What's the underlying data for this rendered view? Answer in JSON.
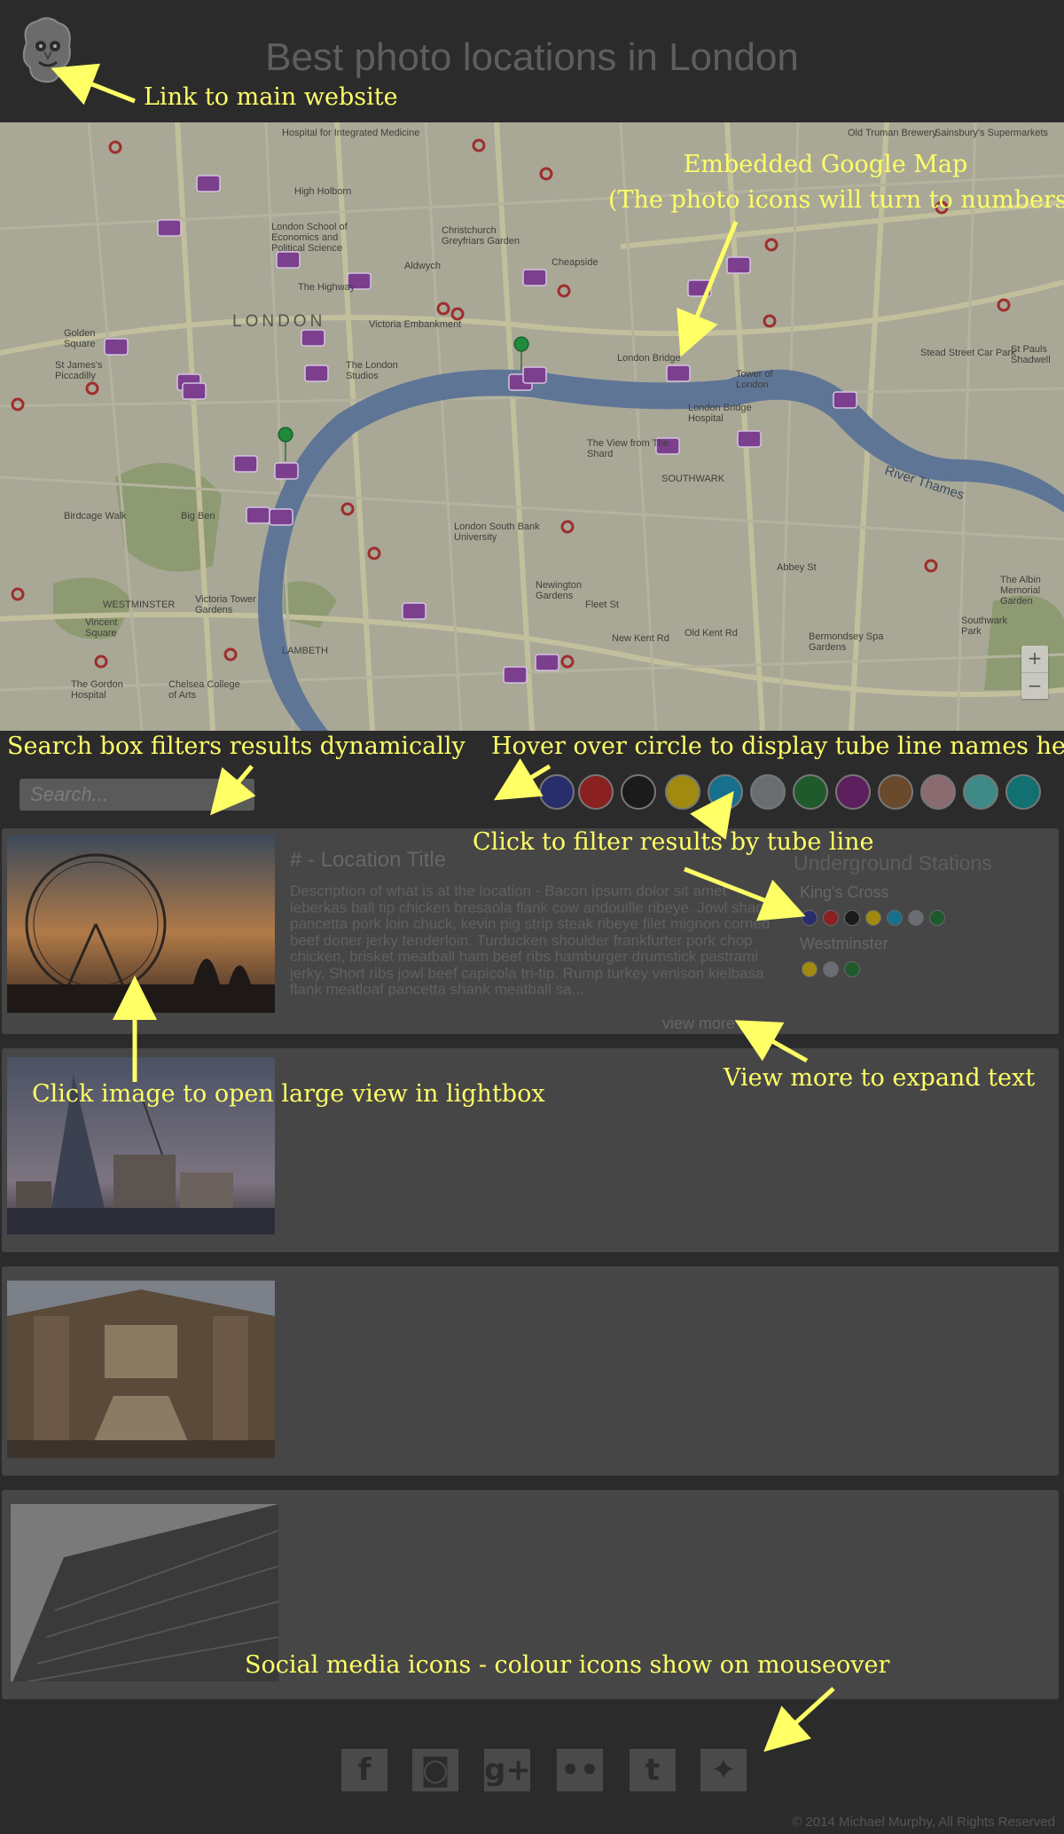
{
  "header": {
    "title": "Best photo locations in London",
    "logo_icon": "cartoon-face-logo-icon"
  },
  "map": {
    "labels": {
      "big": "LONDON",
      "river": "River Thames",
      "places": [
        "Hospital for Integrated Medicine",
        "Old Truman Brewery",
        "Sainsbury's Supermarkets",
        "High Holborn",
        "London School of Economics and Political Science",
        "Christchurch Greyfriars Garden",
        "Cheapside",
        "Golden Square",
        "St James's Piccadilly",
        "The London Studios",
        "Victoria Embankment",
        "London Bridge",
        "Tower of London",
        "London Bridge Hospital",
        "The View from The Shard",
        "SOUTHWARK",
        "London South Bank University",
        "Big Ben",
        "Birdcage Walk",
        "Victoria Tower Gardens",
        "WESTMINSTER",
        "LAMBETH",
        "Newington Gardens",
        "Vincent Square",
        "The Gordon Hospital",
        "Chelsea College of Arts",
        "Bermondsey Spa Gardens",
        "Southwark Park",
        "The Albin Memorial Garden",
        "St Pauls Shadwell",
        "Stead Street Car Park",
        "The Highway",
        "Aldwych",
        "Fleet St",
        "Abbey St",
        "New Kent Rd",
        "Old Kent Rd"
      ]
    },
    "zoom_in": "+",
    "zoom_out": "−"
  },
  "search": {
    "placeholder": "Search..."
  },
  "tube_lines": [
    {
      "color": "#2a2d6b"
    },
    {
      "color": "#8a2020"
    },
    {
      "color": "#1b1b1b"
    },
    {
      "color": "#a08a10"
    },
    {
      "color": "#16708e"
    },
    {
      "color": "#6a6e73"
    },
    {
      "color": "#1f5a2c"
    },
    {
      "color": "#5b1f5d"
    },
    {
      "color": "#6a4a2c"
    },
    {
      "color": "#8a6c70"
    },
    {
      "color": "#3f8a86"
    },
    {
      "color": "#127070"
    }
  ],
  "cards": [
    {
      "title": "# - Location Title",
      "description": "Description of what is at the location - Bacon ipsum dolor sit amet leberkas ball tip chicken bresaola flank cow andouille ribeye. Jowl shank pancetta pork loin chuck, kevin pig strip steak ribeye filet mignon corned beef doner jerky tenderloin. Turducken shoulder frankfurter pork chop chicken, brisket meatball ham beef ribs hamburger drumstick pastrami jerky. Short ribs jowl beef capicola tri-tip. Rump turkey venison kielbasa flank meatloaf pancetta shank meatball sa...",
      "view_more": "view more",
      "stations_title": "Underground Stations",
      "stations": [
        {
          "name": "King's Cross",
          "colors": [
            "#2a2d6b",
            "#8a2020",
            "#1b1b1b",
            "#a08a10",
            "#16708e",
            "#6a6e73",
            "#1f5a2c"
          ]
        },
        {
          "name": "Westminster",
          "colors": [
            "#a08a10",
            "#6a6e73",
            "#1f5a2c"
          ]
        }
      ]
    },
    {},
    {},
    {}
  ],
  "footer": {
    "social": [
      {
        "icon": "facebook-icon",
        "glyph": "f"
      },
      {
        "icon": "instagram-icon",
        "glyph": "◙"
      },
      {
        "icon": "google-plus-icon",
        "glyph": "g+"
      },
      {
        "icon": "flickr-icon",
        "glyph": "••"
      },
      {
        "icon": "tumblr-icon",
        "glyph": "t"
      },
      {
        "icon": "twitter-icon",
        "glyph": "✦"
      }
    ],
    "copyright": "© 2014 Michael Murphy, All Rights Reserved"
  },
  "annotations": {
    "logo": "Link to main website",
    "map_line1": "Embedded Google Map",
    "map_line2": "(The photo icons will turn to numbers)",
    "search": "Search box filters results dynamically",
    "hover": "Hover over circle to display tube line names here",
    "filter": "Click to filter results by tube line",
    "lightbox": "Click image to open large view in lightbox",
    "view_more": "View more to expand text",
    "social": "Social media icons - colour icons show on mouseover"
  }
}
